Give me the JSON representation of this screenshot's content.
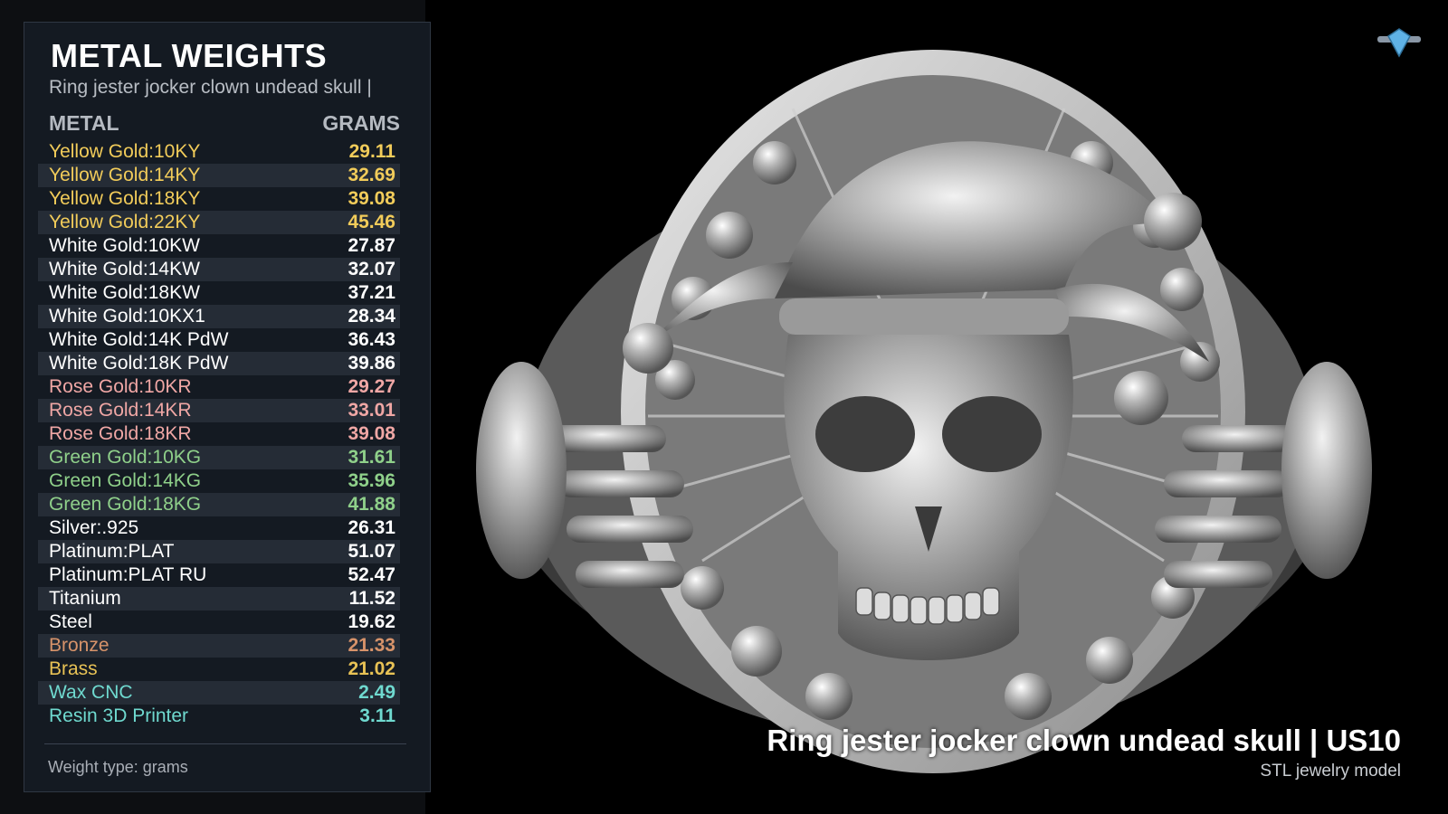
{
  "panel": {
    "title": "METAL WEIGHTS",
    "subtitle": "Ring jester jocker clown undead skull |",
    "col_metal": "METAL",
    "col_grams": "GRAMS",
    "footer": "Weight type: grams"
  },
  "colors": {
    "yellow": "#f2cc5a",
    "white": "#ffffff",
    "rose": "#f0a7a5",
    "green": "#8fd08a",
    "silver": "#ffffff",
    "bronze": "#d7936a",
    "brass": "#e8c255",
    "wax": "#6fd9cf",
    "resin": "#6fd9cf"
  },
  "metals": [
    {
      "name": "Yellow Gold:10KY",
      "grams": "29.11",
      "color": "#f2cc5a"
    },
    {
      "name": "Yellow Gold:14KY",
      "grams": "32.69",
      "color": "#f2cc5a"
    },
    {
      "name": "Yellow Gold:18KY",
      "grams": "39.08",
      "color": "#f2cc5a"
    },
    {
      "name": "Yellow Gold:22KY",
      "grams": "45.46",
      "color": "#f2cc5a"
    },
    {
      "name": "White Gold:10KW",
      "grams": "27.87",
      "color": "#ffffff"
    },
    {
      "name": "White Gold:14KW",
      "grams": "32.07",
      "color": "#ffffff"
    },
    {
      "name": "White Gold:18KW",
      "grams": "37.21",
      "color": "#ffffff"
    },
    {
      "name": "White Gold:10KX1",
      "grams": "28.34",
      "color": "#ffffff"
    },
    {
      "name": "White Gold:14K PdW",
      "grams": "36.43",
      "color": "#ffffff"
    },
    {
      "name": "White Gold:18K PdW",
      "grams": "39.86",
      "color": "#ffffff"
    },
    {
      "name": "Rose Gold:10KR",
      "grams": "29.27",
      "color": "#f0a7a5"
    },
    {
      "name": "Rose Gold:14KR",
      "grams": "33.01",
      "color": "#f0a7a5"
    },
    {
      "name": "Rose Gold:18KR",
      "grams": "39.08",
      "color": "#f0a7a5"
    },
    {
      "name": "Green Gold:10KG",
      "grams": "31.61",
      "color": "#8fd08a"
    },
    {
      "name": "Green Gold:14KG",
      "grams": "35.96",
      "color": "#8fd08a"
    },
    {
      "name": "Green Gold:18KG",
      "grams": "41.88",
      "color": "#8fd08a"
    },
    {
      "name": "Silver:.925",
      "grams": "26.31",
      "color": "#ffffff"
    },
    {
      "name": "Platinum:PLAT",
      "grams": "51.07",
      "color": "#ffffff"
    },
    {
      "name": "Platinum:PLAT RU",
      "grams": "52.47",
      "color": "#ffffff"
    },
    {
      "name": "Titanium",
      "grams": "11.52",
      "color": "#ffffff"
    },
    {
      "name": "Steel",
      "grams": "19.62",
      "color": "#ffffff"
    },
    {
      "name": "Bronze",
      "grams": "21.33",
      "color": "#d7936a"
    },
    {
      "name": "Brass",
      "grams": "21.02",
      "color": "#e8c255"
    },
    {
      "name": "Wax CNC",
      "grams": "2.49",
      "color": "#6fd9cf"
    },
    {
      "name": "Resin 3D Printer",
      "grams": "3.11",
      "color": "#6fd9cf"
    }
  ],
  "viewer": {
    "model_title": "Ring jester jocker clown undead skull | US10",
    "model_subtitle": "STL jewelry model",
    "logo_icon": "diamond-ring-icon"
  }
}
